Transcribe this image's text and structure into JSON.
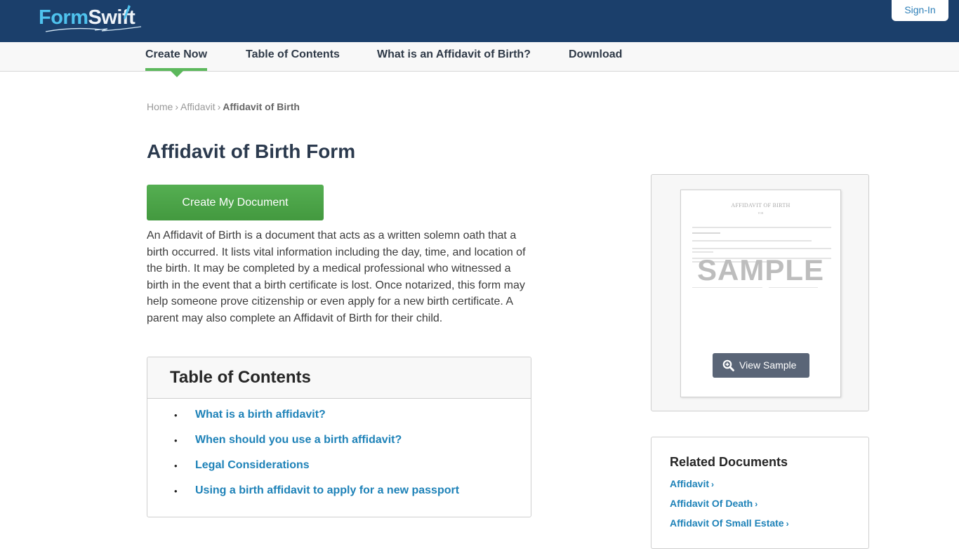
{
  "header": {
    "logo": {
      "part1": "Form",
      "part2": "Swift"
    },
    "signin_label": "Sign-In",
    "colors": {
      "bar": "#1b3f6b",
      "logo_accent": "#4fc3ee"
    }
  },
  "subnav": {
    "items": [
      {
        "label": "Create Now",
        "active": true
      },
      {
        "label": "Table of Contents"
      },
      {
        "label": "What is an Affidavit of Birth?"
      },
      {
        "label": "Download"
      }
    ],
    "active_color": "#5cb85c"
  },
  "breadcrumb": {
    "items": [
      "Home",
      "Affidavit"
    ],
    "separator": "›",
    "current": "Affidavit of Birth"
  },
  "main": {
    "title": "Affidavit of Birth Form",
    "cta_label": "Create My Document",
    "intro": "An Affidavit of Birth is a document that acts as a written solemn oath that a birth occurred. It lists vital information including the day, time, and location of the birth. It may be completed by a medical professional who witnessed a birth in the event that a birth certificate is lost. Once notarized, this form may help someone prove citizenship or even apply for a new birth certificate. A parent may also complete an Affidavit of Birth for their child."
  },
  "toc": {
    "title": "Table of Contents",
    "bullet": "•",
    "items": [
      "What is a birth affidavit?",
      "When should you use a birth affidavit?",
      "Legal Considerations",
      "Using a birth affidavit to apply for a new passport"
    ]
  },
  "sample": {
    "doc_title": "AFFIDAVIT OF BIRTH",
    "doc_sub": "FOR",
    "watermark": "SAMPLE",
    "button_label": "View Sample",
    "button_icon": "zoom-in-icon"
  },
  "related": {
    "title": "Related Documents",
    "arrow": "›",
    "items": [
      "Affidavit",
      "Affidavit Of Death",
      "Affidavit Of Small Estate"
    ]
  }
}
